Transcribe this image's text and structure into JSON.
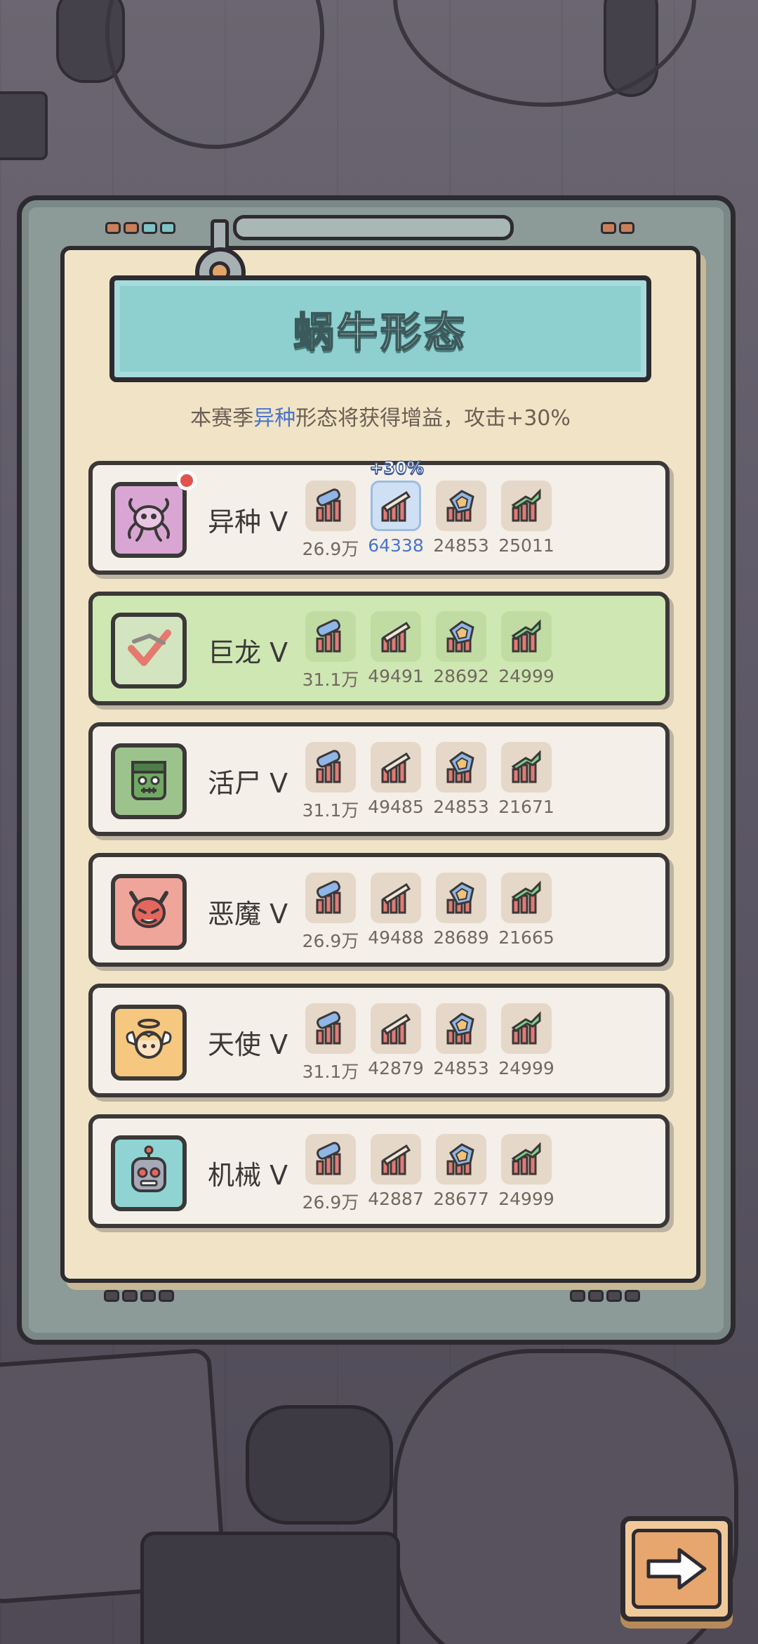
{
  "title": "蜗牛形态",
  "subtitle": {
    "prefix": "本赛季",
    "highlight": "异种",
    "suffix": "形态将获得增益，攻击+30%"
  },
  "boost_tag": "+30%",
  "rows": [
    {
      "name": "异种  V",
      "avatar_icon": "alien-icon",
      "avatar_color": "#d9a6d3",
      "selected": false,
      "has_dot": true,
      "stats": [
        "26.9万",
        "64338",
        "24853",
        "25011"
      ],
      "boosted_index": 1
    },
    {
      "name": "巨龙  V",
      "avatar_icon": "dragon-icon",
      "avatar_color": "#d3e4c0",
      "selected": true,
      "has_dot": false,
      "stats": [
        "31.1万",
        "49491",
        "28692",
        "24999"
      ],
      "boosted_index": -1
    },
    {
      "name": "活尸  V",
      "avatar_icon": "zombie-icon",
      "avatar_color": "#9cc38c",
      "selected": false,
      "has_dot": false,
      "stats": [
        "31.1万",
        "49485",
        "24853",
        "21671"
      ],
      "boosted_index": -1
    },
    {
      "name": "恶魔  V",
      "avatar_icon": "demon-icon",
      "avatar_color": "#f0a59a",
      "selected": false,
      "has_dot": false,
      "stats": [
        "26.9万",
        "49488",
        "28689",
        "21665"
      ],
      "boosted_index": -1
    },
    {
      "name": "天使  V",
      "avatar_icon": "angel-icon",
      "avatar_color": "#f6c77f",
      "selected": false,
      "has_dot": false,
      "stats": [
        "31.1万",
        "42879",
        "24853",
        "24999"
      ],
      "boosted_index": -1
    },
    {
      "name": "机械  V",
      "avatar_icon": "robot-icon",
      "avatar_color": "#8fd4d2",
      "selected": false,
      "has_dot": false,
      "stats": [
        "26.9万",
        "42887",
        "28677",
        "24999"
      ],
      "boosted_index": -1
    }
  ],
  "stat_icons": [
    "health-stat-icon",
    "attack-stat-icon",
    "defense-stat-icon",
    "speed-stat-icon"
  ],
  "next_button_icon": "arrow-right-icon"
}
